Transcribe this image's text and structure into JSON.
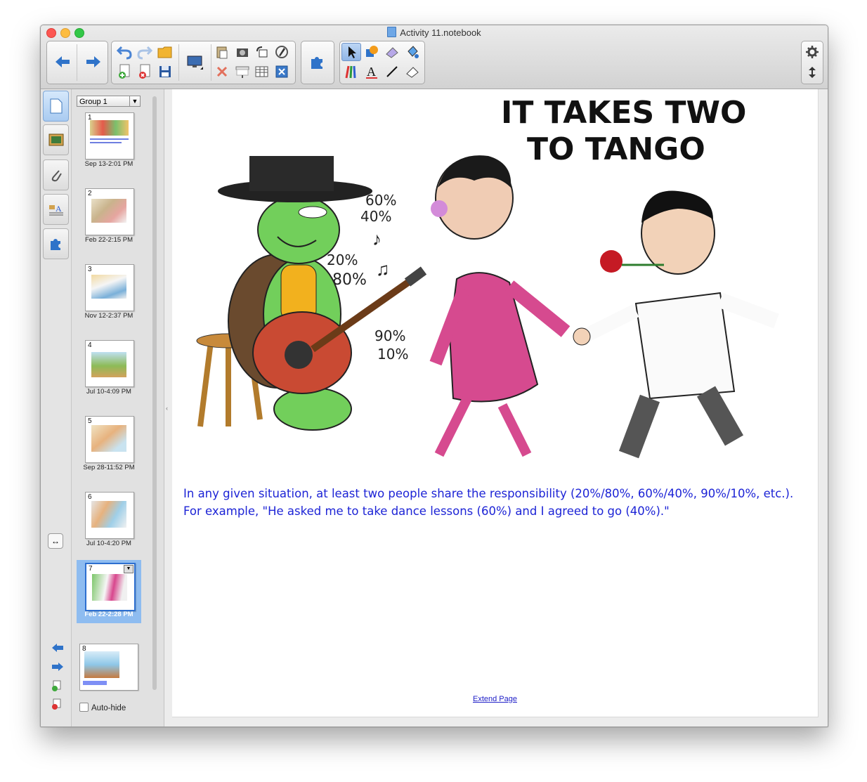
{
  "window": {
    "title": "Activity 11.notebook"
  },
  "toolbar": {
    "icons": [
      "back-arrow",
      "forward-arrow",
      "undo",
      "redo",
      "open-folder",
      "add-page",
      "delete-page",
      "save",
      "screen-display",
      "paste",
      "screenshot",
      "rotate",
      "properties",
      "delete",
      "screen-shade",
      "table",
      "fullscreen",
      "addon-puzzle",
      "select-pointer",
      "shapes",
      "eraser",
      "fill",
      "pens",
      "text",
      "line",
      "creative-eraser",
      "gear",
      "expand"
    ]
  },
  "sorter": {
    "group_label": "Group 1",
    "auto_hide_label": "Auto-hide",
    "pages": [
      {
        "num": "1",
        "date": "Sep 13-2:01 PM"
      },
      {
        "num": "2",
        "date": "Feb 22-2:15 PM"
      },
      {
        "num": "3",
        "date": "Nov 12-2:37 PM"
      },
      {
        "num": "4",
        "date": "Jul 10-4:09 PM"
      },
      {
        "num": "5",
        "date": "Sep 28-11:52 PM"
      },
      {
        "num": "6",
        "date": "Jul 10-4:20 PM"
      },
      {
        "num": "7",
        "date": "Feb 22-2:28 PM",
        "selected": true
      },
      {
        "num": "8",
        "date": ""
      }
    ]
  },
  "page": {
    "cartoon_title_line1": "IT TAKES TWO",
    "cartoon_title_line2": "TO TANGO",
    "percent_labels": [
      "60%",
      "40%",
      "20%",
      "80%",
      "90%",
      "10%"
    ],
    "caption_line1": "In any given situation, at least two people share the responsibility (20%/80%, 60%/40%, 90%/10%, etc.).",
    "caption_line2": "For example, \"He asked me to take dance lessons (60%) and I agreed to go (40%).\"",
    "extend_link": "Extend Page"
  },
  "colors": {
    "caption": "#1d24d6",
    "accent": "#3d7fd6",
    "selected_thumb": "#8ebcf0"
  }
}
